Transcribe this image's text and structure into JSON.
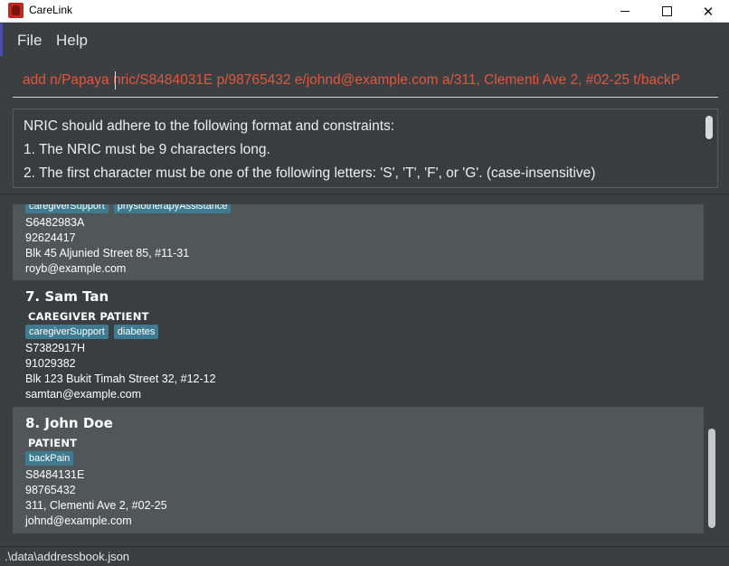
{
  "window": {
    "title": "CareLink"
  },
  "menu": {
    "file": "File",
    "help": "Help"
  },
  "command": {
    "value": "add n/Papaya nric/S8484031E p/98765432 e/johnd@example.com a/311, Clementi Ave 2, #02-25 t/backP"
  },
  "result": {
    "lines": [
      "NRIC should adhere to the following format and constraints:",
      "1. The NRIC must be 9 characters long.",
      "2. The first character must be one of the following letters: 'S', 'T', 'F', or 'G'. (case-insensitive)"
    ]
  },
  "persons": [
    {
      "tags": [
        "caregiverSupport",
        "physiotherapyAssistance"
      ],
      "nric": "S6482983A",
      "phone": "92624417",
      "address": "Blk 45 Aljunied Street 85, #11-31",
      "email": "royb@example.com"
    },
    {
      "name": "7. Sam Tan",
      "roles": "CAREGIVER  PATIENT",
      "tags": [
        "caregiverSupport",
        "diabetes"
      ],
      "nric": "S7382917H",
      "phone": "91029382",
      "address": "Blk 123 Bukit Timah Street 32, #12-12",
      "email": "samtan@example.com"
    },
    {
      "name": "8. John Doe",
      "roles": "PATIENT",
      "tags": [
        "backPain"
      ],
      "nric": "S8484131E",
      "phone": "98765432",
      "address": "311, Clementi Ave 2, #02-25",
      "email": "johnd@example.com"
    }
  ],
  "status": {
    "file_path": ".\\data\\addressbook.json"
  },
  "colors": {
    "accent": "#4b4ba8",
    "tag_bg": "#3e7b91",
    "error_text": "#e0563c",
    "card_light": "#515658",
    "card_dark": "#3b3e41"
  }
}
